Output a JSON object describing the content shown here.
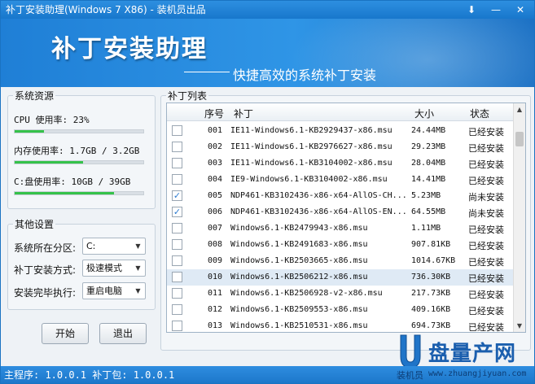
{
  "window": {
    "title": "补丁安装助理(Windows 7 X86) - 装机员出品",
    "minimize_glyph": "⬇",
    "min_glyph": "—",
    "close_glyph": "✕"
  },
  "banner": {
    "title": "补丁安装助理",
    "subtitle": "快捷高效的系统补丁安装"
  },
  "resources": {
    "legend": "系统资源",
    "cpu_label": "CPU 使用率: 23%",
    "cpu_fraction": 0.23,
    "mem_label": "内存使用率: 1.7GB / 3.2GB",
    "mem_fraction": 0.53,
    "disk_label": "C:盘使用率: 10GB / 39GB",
    "disk_fraction": 0.77
  },
  "settings": {
    "legend": "其他设置",
    "partition_label": "系统所在分区:",
    "partition_value": "C:",
    "install_mode_label": "补丁安装方式:",
    "install_mode_value": "极速模式",
    "after_install_label": "安装完毕执行:",
    "after_install_value": "重启电脑"
  },
  "buttons": {
    "start": "开始",
    "exit": "退出"
  },
  "patch_list": {
    "legend": "补丁列表",
    "headers": {
      "seq": "序号",
      "patch": "补丁",
      "size": "大小",
      "status": "状态"
    },
    "rows": [
      {
        "checked": false,
        "seq": "001",
        "patch": "IE11-Windows6.1-KB2929437-x86.msu",
        "size": "24.44MB",
        "status": "已经安装"
      },
      {
        "checked": false,
        "seq": "002",
        "patch": "IE11-Windows6.1-KB2976627-x86.msu",
        "size": "29.23MB",
        "status": "已经安装"
      },
      {
        "checked": false,
        "seq": "003",
        "patch": "IE11-Windows6.1-KB3104002-x86.msu",
        "size": "28.04MB",
        "status": "已经安装"
      },
      {
        "checked": false,
        "seq": "004",
        "patch": "IE9-Windows6.1-KB3104002-x86.msu",
        "size": "14.41MB",
        "status": "已经安装"
      },
      {
        "checked": true,
        "seq": "005",
        "patch": "NDP461-KB3102436-x86-x64-AllOS-CH...",
        "size": "5.23MB",
        "status": "尚未安装"
      },
      {
        "checked": true,
        "seq": "006",
        "patch": "NDP461-KB3102436-x86-x64-AllOS-EN...",
        "size": "64.55MB",
        "status": "尚未安装"
      },
      {
        "checked": false,
        "seq": "007",
        "patch": "Windows6.1-KB2479943-x86.msu",
        "size": "1.11MB",
        "status": "已经安装"
      },
      {
        "checked": false,
        "seq": "008",
        "patch": "Windows6.1-KB2491683-x86.msu",
        "size": "907.81KB",
        "status": "已经安装"
      },
      {
        "checked": false,
        "seq": "009",
        "patch": "Windows6.1-KB2503665-x86.msu",
        "size": "1014.67KB",
        "status": "已经安装"
      },
      {
        "checked": false,
        "seq": "010",
        "patch": "Windows6.1-KB2506212-x86.msu",
        "size": "736.30KB",
        "status": "已经安装",
        "selected": true
      },
      {
        "checked": false,
        "seq": "011",
        "patch": "Windows6.1-KB2506928-v2-x86.msu",
        "size": "217.73KB",
        "status": "已经安装"
      },
      {
        "checked": false,
        "seq": "012",
        "patch": "Windows6.1-KB2509553-x86.msu",
        "size": "409.16KB",
        "status": "已经安装"
      },
      {
        "checked": false,
        "seq": "013",
        "patch": "Windows6.1-KB2510531-x86.msu",
        "size": "694.73KB",
        "status": "已经安装"
      }
    ]
  },
  "statusbar": {
    "text": "主程序: 1.0.0.1 补丁包: 1.0.0.1"
  },
  "watermark": {
    "brand": "盘量产网",
    "site_cn": "装机员",
    "url": "www.zhuangjiyuan.com"
  },
  "colors": {
    "accent": "#1877cc",
    "progress": "#35c24a"
  }
}
